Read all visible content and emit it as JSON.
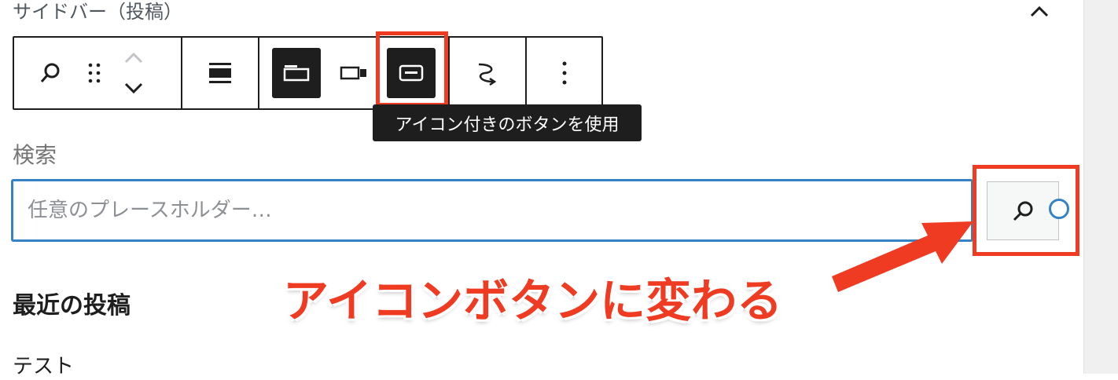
{
  "panel": {
    "title": "サイドバー（投稿）"
  },
  "toolbar": {
    "tooltip": "アイコン付きのボタンを使用"
  },
  "search": {
    "label": "検索",
    "placeholder": "任意のプレースホルダー…"
  },
  "latest_posts": {
    "heading": "最近の投稿",
    "items": [
      "テスト"
    ]
  },
  "annotation": {
    "text": "アイコンボタンに変わる"
  },
  "colors": {
    "accent_blue": "#3582c4",
    "annotation_red": "#ef3b22",
    "toolbar_dark": "#1e1e1e"
  },
  "icons": {
    "collapse": "chevron-up-icon",
    "search": "search-icon",
    "drag": "drag-handle-icon",
    "move_up": "chevron-up-icon",
    "move_down": "chevron-down-icon",
    "align": "align-wide-icon",
    "button_outside": "button-outside-icon",
    "button_inside": "button-inside-icon",
    "button_icon": "button-icon-only-icon",
    "transform": "transform-icon",
    "options": "more-vertical-icon"
  }
}
